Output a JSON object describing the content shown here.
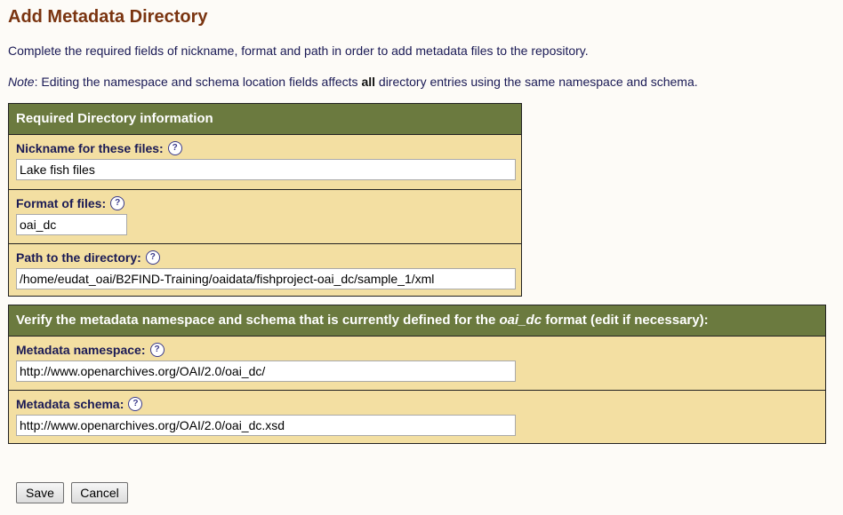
{
  "page": {
    "title": "Add Metadata Directory",
    "intro": "Complete the required fields of nickname, format and path in order to add metadata files to the repository.",
    "note": {
      "label": "Note",
      "before": ": Editing the namespace and schema location fields affects ",
      "bold": "all",
      "after": " directory entries using the same namespace and schema."
    }
  },
  "required": {
    "header": "Required Directory information",
    "nickname": {
      "label": "Nickname for these files:",
      "value": "Lake fish files"
    },
    "format": {
      "label": "Format of files:",
      "value": "oai_dc"
    },
    "path": {
      "label": "Path to the directory:",
      "value": "/home/eudat_oai/B2FIND-Training/oaidata/fishproject-oai_dc/sample_1/xml"
    }
  },
  "verify": {
    "header_before": "Verify the metadata namespace and schema that is currently defined for the ",
    "header_format": "oai_dc",
    "header_after": " format (edit if necessary):",
    "namespace": {
      "label": "Metadata namespace:",
      "value": "http://www.openarchives.org/OAI/2.0/oai_dc/"
    },
    "schema": {
      "label": "Metadata schema:",
      "value": "http://www.openarchives.org/OAI/2.0/oai_dc.xsd"
    }
  },
  "help_glyph": "?",
  "buttons": {
    "save": "Save",
    "cancel": "Cancel"
  },
  "colors": {
    "title": "#7a3410",
    "header_bg": "#6b7a3f",
    "panel_bg": "#f3dfa2",
    "text": "#1a1a55"
  }
}
